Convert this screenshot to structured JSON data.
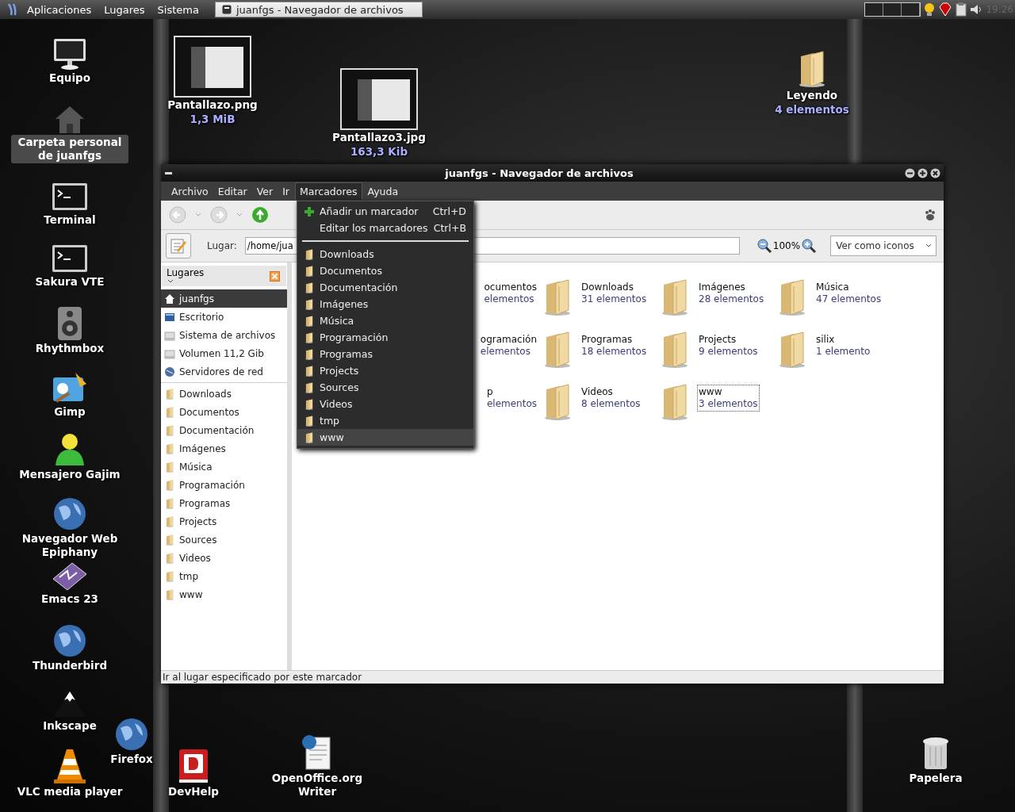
{
  "panel": {
    "menus": [
      "Aplicaciones",
      "Lugares",
      "Sistema"
    ],
    "tasks": [
      {
        "label": "juanfgs - Navegador de archivos",
        "selected": true
      }
    ],
    "clock": "19:26"
  },
  "desktop_icons": [
    {
      "label": "Equipo",
      "kind": "monitor",
      "selected": false
    },
    {
      "label": "Carpeta personal de juanfgs",
      "kind": "home",
      "selected": true
    },
    {
      "label": "Terminal",
      "kind": "terminal",
      "selected": false
    },
    {
      "label": "Sakura VTE",
      "kind": "terminal",
      "selected": false
    },
    {
      "label": "Rhythmbox",
      "kind": "speaker",
      "selected": false
    },
    {
      "label": "Gimp",
      "kind": "paint",
      "selected": false
    },
    {
      "label": "Mensajero Gajim",
      "kind": "person",
      "selected": false
    },
    {
      "label": "Navegador Web Epiphany",
      "kind": "globe",
      "selected": false
    },
    {
      "label": "Emacs 23",
      "kind": "pen",
      "selected": false
    },
    {
      "label": "Thunderbird",
      "kind": "globe",
      "selected": false
    },
    {
      "label": "Inkscape",
      "kind": "mountain",
      "selected": false
    },
    {
      "label": "VLC media player",
      "kind": "cone",
      "selected": false
    },
    {
      "label": "Firefox",
      "kind": "globe",
      "selected": false
    },
    {
      "label": "DevHelp",
      "kind": "book",
      "selected": false
    },
    {
      "label": "OpenOffice.org Writer",
      "kind": "document",
      "selected": false
    },
    {
      "label": "Papelera",
      "kind": "trash",
      "selected": false
    },
    {
      "label": "Leyendo",
      "sublabel": "4 elementos",
      "kind": "folder",
      "selected": false
    },
    {
      "label": "Pantallazo.png",
      "sublabel": "1,3 MiB",
      "kind": "thumbnail",
      "selected": false
    },
    {
      "label": "Pantallazo3.jpg",
      "sublabel": "163,3 Kib",
      "kind": "thumbnail",
      "selected": false
    }
  ],
  "window": {
    "title": "juanfgs - Navegador de archivos",
    "menubar": [
      {
        "label": "Archivo",
        "selected": false
      },
      {
        "label": "Editar",
        "selected": false
      },
      {
        "label": "Ver",
        "selected": false
      },
      {
        "label": "Ir",
        "selected": false
      },
      {
        "label": "Marcadores",
        "selected": true
      },
      {
        "label": "Ayuda",
        "selected": false
      }
    ],
    "location": {
      "label": "Lugar:",
      "value": "/home/jua"
    },
    "zoom": "100%",
    "view_mode": "Ver como iconos",
    "sidebar": {
      "title": "Lugares",
      "places": [
        {
          "label": "juanfgs",
          "kind": "home",
          "selected": true
        },
        {
          "label": "Escritorio",
          "kind": "desktop",
          "selected": false
        },
        {
          "label": "Sistema de archivos",
          "kind": "drive",
          "selected": false
        },
        {
          "label": "Volumen 11,2 Gib",
          "kind": "drive",
          "selected": false
        },
        {
          "label": "Servidores de red",
          "kind": "network",
          "selected": false
        }
      ],
      "bookmarks": [
        {
          "label": "Downloads",
          "selected": false
        },
        {
          "label": "Documentos",
          "selected": false
        },
        {
          "label": "Documentación",
          "selected": false
        },
        {
          "label": "Imágenes",
          "selected": false
        },
        {
          "label": "Música",
          "selected": false
        },
        {
          "label": "Programación",
          "selected": false
        },
        {
          "label": "Programas",
          "selected": false
        },
        {
          "label": "Projects",
          "selected": false
        },
        {
          "label": "Sources",
          "selected": false
        },
        {
          "label": "Videos",
          "selected": false
        },
        {
          "label": "tmp",
          "selected": false
        },
        {
          "label": "www",
          "selected": false
        }
      ]
    },
    "items": [
      {
        "name": "ocumentos",
        "count": "elementos",
        "selected": false
      },
      {
        "name": "Downloads",
        "count": "31 elementos",
        "selected": false
      },
      {
        "name": "Imágenes",
        "count": "28 elementos",
        "selected": false
      },
      {
        "name": "Música",
        "count": "47 elementos",
        "selected": false
      },
      {
        "name": "ogramación",
        "count": "elementos",
        "selected": false
      },
      {
        "name": "Programas",
        "count": "18 elementos",
        "selected": false
      },
      {
        "name": "Projects",
        "count": "9 elementos",
        "selected": false
      },
      {
        "name": "silix",
        "count": "1 elemento",
        "selected": false
      },
      {
        "name": "p",
        "count": "elementos",
        "selected": false
      },
      {
        "name": "Videos",
        "count": "8 elementos",
        "selected": false
      },
      {
        "name": "www",
        "count": "3 elementos",
        "selected": true
      }
    ],
    "status_bar": "Ir al lugar especificado por este marcador",
    "open_menu": {
      "items": [
        {
          "kind": "add",
          "label": "Añadir un marcador",
          "shortcut": "Ctrl+D",
          "selected": false
        },
        {
          "kind": "action",
          "label": "Editar los marcadores",
          "shortcut": "Ctrl+B",
          "selected": false
        },
        {
          "kind": "separator"
        },
        {
          "kind": "bookmark",
          "label": "Downloads",
          "selected": false
        },
        {
          "kind": "bookmark",
          "label": "Documentos",
          "selected": false
        },
        {
          "kind": "bookmark",
          "label": "Documentación",
          "selected": false
        },
        {
          "kind": "bookmark",
          "label": "Imágenes",
          "selected": false
        },
        {
          "kind": "bookmark",
          "label": "Música",
          "selected": false
        },
        {
          "kind": "bookmark",
          "label": "Programación",
          "selected": false
        },
        {
          "kind": "bookmark",
          "label": "Programas",
          "selected": false
        },
        {
          "kind": "bookmark",
          "label": "Projects",
          "selected": false
        },
        {
          "kind": "bookmark",
          "label": "Sources",
          "selected": false
        },
        {
          "kind": "bookmark",
          "label": "Videos",
          "selected": false
        },
        {
          "kind": "bookmark",
          "label": "tmp",
          "selected": false
        },
        {
          "kind": "bookmark",
          "label": "www",
          "selected": true
        }
      ]
    }
  }
}
